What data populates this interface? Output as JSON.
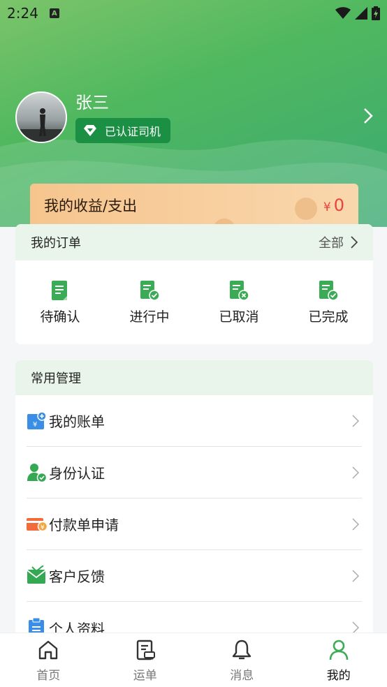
{
  "status_bar": {
    "time": "2:24",
    "notification": "A"
  },
  "profile": {
    "name": "张三",
    "badge": "已认证司机"
  },
  "income": {
    "title": "我的收益/支出",
    "currency": "¥",
    "amount": "0"
  },
  "orders": {
    "title": "我的订单",
    "view_all": "全部",
    "items": [
      {
        "label": "待确认",
        "icon": "document-pending-icon"
      },
      {
        "label": "进行中",
        "icon": "document-check-icon"
      },
      {
        "label": "已取消",
        "icon": "document-cancel-icon"
      },
      {
        "label": "已完成",
        "icon": "document-done-icon"
      }
    ]
  },
  "manage": {
    "title": "常用管理",
    "items": [
      {
        "label": "我的账单",
        "icon": "bill-icon"
      },
      {
        "label": "身份认证",
        "icon": "identity-icon"
      },
      {
        "label": "付款单申请",
        "icon": "payment-card-icon"
      },
      {
        "label": "客户反馈",
        "icon": "feedback-mail-icon"
      },
      {
        "label": "个人资料",
        "icon": "profile-doc-icon"
      }
    ]
  },
  "tabs": [
    {
      "label": "首页",
      "icon": "home-icon",
      "active": false
    },
    {
      "label": "运单",
      "icon": "waybill-icon",
      "active": false
    },
    {
      "label": "消息",
      "icon": "bell-icon",
      "active": false
    },
    {
      "label": "我的",
      "icon": "person-icon",
      "active": true
    }
  ],
  "colors": {
    "brand_green": "#3aa972",
    "badge_green": "#1b8f43",
    "income_red": "#e8443a",
    "orange": "#f6c58e"
  }
}
